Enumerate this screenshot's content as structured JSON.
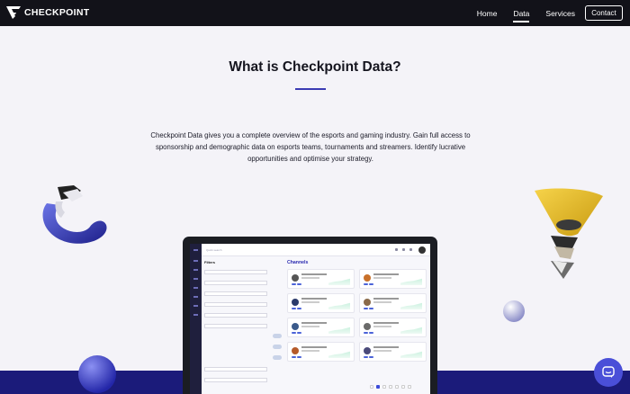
{
  "brand": {
    "name": "CHECKPOINT"
  },
  "nav": {
    "links": [
      {
        "label": "Home",
        "active": false
      },
      {
        "label": "Data",
        "active": true
      },
      {
        "label": "Services",
        "active": false
      }
    ],
    "contact_label": "Contact"
  },
  "hero": {
    "title": "What is Checkpoint Data?",
    "description": "Checkpoint Data gives you a complete overview of the esports and gaming industry. Gain full access to sponsorship and demographic data on esports teams, tournaments and streamers. Identify lucrative opportunities and optimise your strategy."
  },
  "app_preview": {
    "filters_title": "Filters",
    "channels_title": "Channels",
    "search_placeholder": "Quick search"
  },
  "colors": {
    "nav_bg": "#121219",
    "accent": "#3b3bb3",
    "band": "#1b1b7a",
    "chat": "#4a4fd8"
  },
  "icons": {
    "chat": "chat-bubble-icon",
    "logo": "checkpoint-logo-icon"
  }
}
